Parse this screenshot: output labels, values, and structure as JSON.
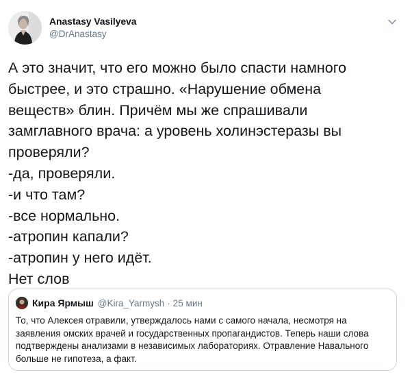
{
  "author": {
    "display_name": "Anastasy Vasilyeva",
    "handle": "@DrAnastasy",
    "avatar_icon": "profile-photo"
  },
  "menu_icon": "chevron-down-icon",
  "tweet": {
    "text": "А это значит, что его можно было спасти намного\nбыстрее, и это страшно. «Нарушение обмена\nвеществ» блин. Причём мы же спрашивали\nзамглавного врача: а уровень холинэстеразы вы\nпроверяли?\n-да, проверяли.\n-и что там?\n-все нормально.\n-атропин капали?\n-атропин у него идёт.\nНет слов"
  },
  "quoted_tweet": {
    "display_name": "Кира Ярмыш",
    "handle": "@Kira_Yarmysh",
    "separator": "·",
    "time": "25 мин",
    "text": "То, что Алексея отравили, утверждалось нами с самого начала, несмотря на заявления омских врачей и государственных пропагандистов. Теперь наши слова подтверждены анализами в независимых лабораториях. Отравление Навального больше не гипотеза, а факт."
  },
  "colors": {
    "text_primary": "#14171a",
    "text_secondary": "#657786",
    "border": "#ccd6dd",
    "background": "#ffffff"
  }
}
